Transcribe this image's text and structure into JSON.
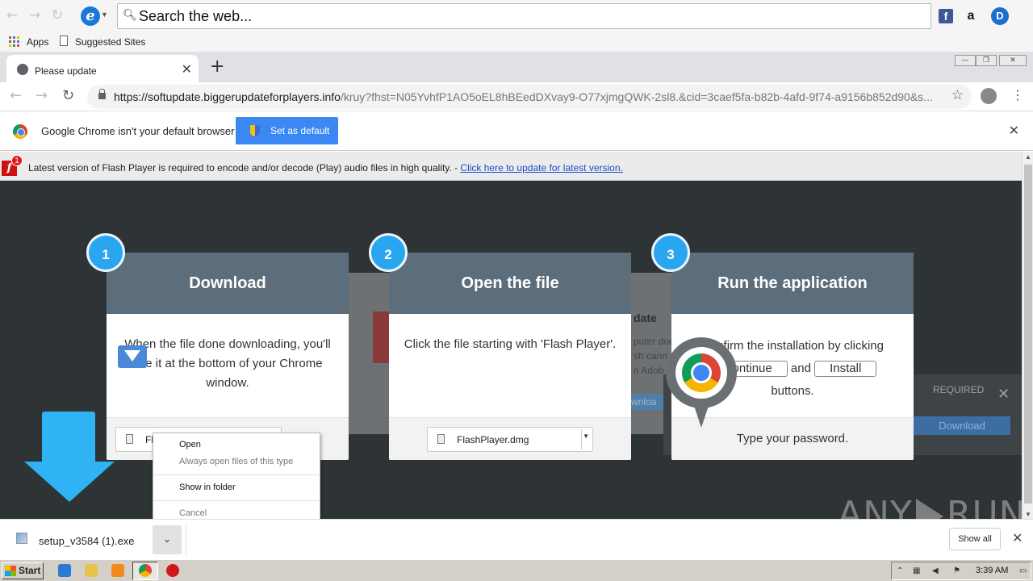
{
  "ie_toolbar": {
    "search_placeholder": "Search the web...",
    "ext_facebook": "f",
    "ext_amazon": "a",
    "ext_d": "D"
  },
  "bookmarks": {
    "apps": "Apps",
    "suggested": "Suggested Sites"
  },
  "tab": {
    "title": "Please update",
    "close": "✕",
    "new_tab": "+"
  },
  "window_controls": {
    "minimize": "—",
    "restore": "❐",
    "close": "✕"
  },
  "omnibox": {
    "url_host": "https://softupdate.biggerupdateforplayers.info",
    "url_path": "/kruy?fhst=N05YvhfP1AO5oEL8hBEedDXvay9-O77xjmgQWK-2sl8.&cid=3caef5fa-b82b-4afd-9f74-a9156b852d90&s..."
  },
  "infobar": {
    "message": "Google Chrome isn't your default browser",
    "button": "Set as default",
    "close": "✕"
  },
  "flash_bar": {
    "badge": "1",
    "text": "Latest version of Flash Player is required to encode and/or decode (Play) audio files in high quality. - ",
    "link": "Click here to update for latest version."
  },
  "background_modal": {
    "title": "date",
    "line1": "puter doe",
    "line2": "sh cann",
    "line3": "n Adob",
    "button": "wnloa",
    "required": "REQUIRED",
    "close": "✕",
    "download": "Download"
  },
  "steps": [
    {
      "number": "1",
      "title": "Download",
      "body": "When the file done downloading, you'll see it at the bottom of your Chrome window.",
      "chip": "Fl"
    },
    {
      "number": "2",
      "title": "Open the file",
      "body": "Click the file starting with 'Flash Player'.",
      "chip": "FlashPlayer.dmg"
    },
    {
      "number": "3",
      "title": "Run the application",
      "body_pre": "Confirm the installation by clicking",
      "btn_continue": "Continue",
      "and": "and",
      "btn_install": "Install",
      "buttons": "buttons.",
      "footer": "Type your password."
    }
  ],
  "context_menu": {
    "open": "Open",
    "always_open": "Always open files of this type",
    "show_in_folder": "Show in folder",
    "cancel": "Cancel"
  },
  "download_shelf": {
    "filename": "setup_v3584 (1).exe",
    "show_all": "Show all",
    "close": "✕"
  },
  "watermark": {
    "left": "ANY",
    "right": "RUN"
  },
  "taskbar": {
    "start": "Start",
    "time": "3:39 AM"
  }
}
